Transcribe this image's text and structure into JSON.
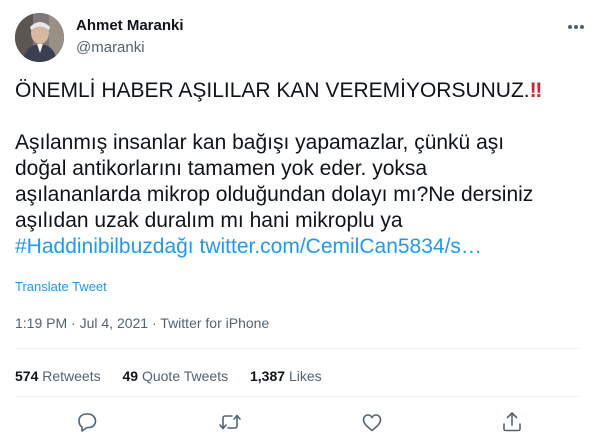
{
  "author": {
    "name": "Ahmet Maranki",
    "handle": "@maranki"
  },
  "tweet": {
    "headline": "ÖNEMLİ HABER AŞILILAR KAN VEREMİYORSUNUZ.",
    "headline_emoji": "‼",
    "body_lines": [
      "Aşılanmış insanlar kan bağışı yapamazlar, çünkü aşı",
      "doğal antikorlarını tamamen yok eder. yoksa",
      "aşılananlarda mikrop olduğundan dolayı mı?Ne dersiniz",
      "aşılıdan uzak duralım mı hani mikroplu ya"
    ],
    "hashtag": "#Haddinibilbuzdağı",
    "link": "twitter.com/CemilCan5834/s…"
  },
  "translate_label": "Translate Tweet",
  "meta": {
    "time": "1:19 PM",
    "separator": "·",
    "date": "Jul 4, 2021",
    "source": "Twitter for iPhone"
  },
  "stats": {
    "retweets_count": "574",
    "retweets_label": "Retweets",
    "quotes_count": "49",
    "quotes_label": "Quote Tweets",
    "likes_count": "1,387",
    "likes_label": "Likes"
  },
  "icons": {
    "reply": "reply-icon",
    "retweet": "retweet-icon",
    "like": "heart-icon",
    "share": "share-icon",
    "more": "more-icon"
  },
  "colors": {
    "link": "#1d9bf0",
    "text": "#0f1419",
    "secondary": "#536471",
    "divider": "#eff3f4",
    "emoji": "#d0212d"
  }
}
